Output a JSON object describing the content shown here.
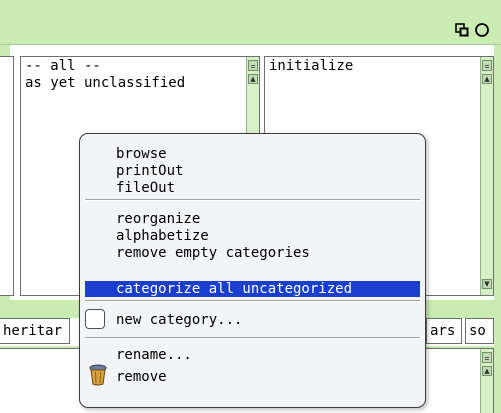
{
  "window": {
    "collapse_icon": "collapse-icon",
    "close_icon": "close-icon"
  },
  "panes": {
    "categories": {
      "items": [
        "-- all --",
        "as yet unclassified"
      ]
    },
    "selectors": {
      "items": [
        "initialize"
      ]
    }
  },
  "buttons": {
    "inheritance": "heritar",
    "vars": "ars",
    "source": "so"
  },
  "menu": {
    "items_group1": [
      "browse",
      "printOut",
      "fileOut"
    ],
    "items_group2": [
      "reorganize",
      "alphabetize",
      "remove empty categories"
    ],
    "selected_item": "categorize all uncategorized",
    "new_category": "new category...",
    "rename": "rename...",
    "remove": "remove",
    "new_category_icon": "checkbox-icon",
    "remove_icon": "trash-can-icon"
  },
  "colors": {
    "window_frame": "#c8ecb1",
    "menu_background": "#f2f4f8",
    "selection": "#1a3fce"
  }
}
